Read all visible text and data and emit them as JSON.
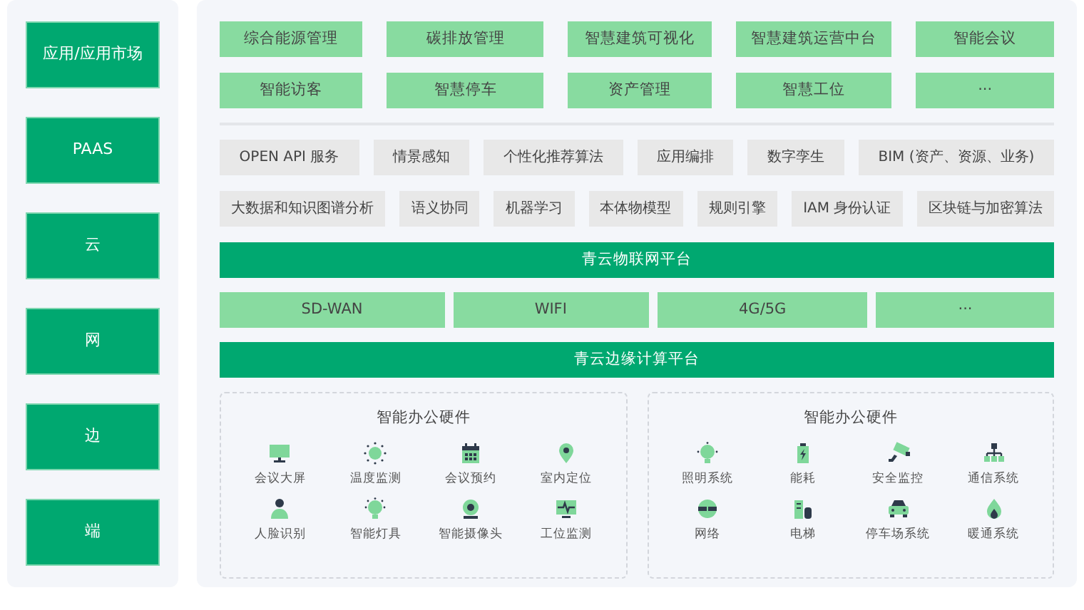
{
  "sidebar": {
    "items": [
      "应用/应用市场",
      "PAAS",
      "云",
      "网",
      "边",
      "端"
    ]
  },
  "applications": [
    "综合能源管理",
    "碳排放管理",
    "智慧建筑可视化",
    "智慧建筑运营中台",
    "智能会议",
    "智能访客",
    "智慧停车",
    "资产管理",
    "智慧工位",
    "···"
  ],
  "capability_rows": [
    {
      "items": [
        "OPEN API 服务",
        "情景感知",
        "个性化推荐算法",
        "应用编排",
        "数字孪生",
        "BIM (资产、资源、业务)"
      ]
    },
    {
      "items": [
        "大数据和知识图谱分析",
        "语义协同",
        "机器学习",
        "本体物模型",
        "规则引擎",
        "IAM  身份认证",
        "区块链与加密算法"
      ]
    }
  ],
  "iot_platform": "青云物联网平台",
  "networks": [
    "SD-WAN",
    "WIFI",
    "4G/5G",
    "···"
  ],
  "edge_platform": "青云边缘计算平台",
  "hardware_groups": [
    {
      "title": "智能办公硬件",
      "items": [
        "会议大屏",
        "温度监测",
        "会议预约",
        "室内定位",
        "人脸识别",
        "智能灯具",
        "智能摄像头",
        "工位监测"
      ]
    },
    {
      "title": "智能办公硬件",
      "items": [
        "照明系统",
        "能耗",
        "安全监控",
        "通信系统",
        "网络",
        "电梯",
        "停车场系统",
        "暖通系统"
      ]
    }
  ]
}
